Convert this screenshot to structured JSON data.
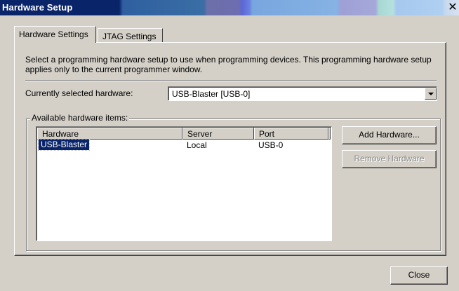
{
  "window": {
    "title": "Hardware Setup",
    "close_glyph": "✕"
  },
  "tabs": [
    {
      "label": "Hardware Settings",
      "active": true
    },
    {
      "label": "JTAG Settings",
      "active": false
    }
  ],
  "hardware_settings": {
    "description": "Select a programming hardware setup to use when programming devices. This programming hardware setup applies only to the current programmer window.",
    "current_label": "Currently selected hardware:",
    "current_value": "USB-Blaster [USB-0]",
    "group_label": "Available hardware items:",
    "columns": [
      "Hardware",
      "Server",
      "Port"
    ],
    "rows": [
      {
        "hardware": "USB-Blaster",
        "server": "Local",
        "port": "USB-0",
        "selected": true
      }
    ],
    "add_button": "Add Hardware...",
    "remove_button": "Remove Hardware",
    "remove_enabled": false
  },
  "footer": {
    "close_button": "Close"
  },
  "colors": {
    "titlebar_start": "#0a246a",
    "selection": "#0a246a",
    "face": "#d4d0c8"
  }
}
